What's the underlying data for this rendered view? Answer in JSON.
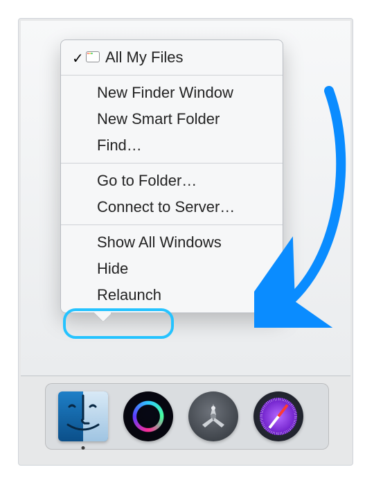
{
  "menu": {
    "items": [
      {
        "label": "All My Files",
        "checked": true,
        "hasWindowIcon": true
      },
      {
        "label": "New Finder Window"
      },
      {
        "label": "New Smart Folder"
      },
      {
        "label": "Find…"
      },
      {
        "label": "Go to Folder…"
      },
      {
        "label": "Connect to Server…"
      },
      {
        "label": "Show All Windows"
      },
      {
        "label": "Hide"
      },
      {
        "label": "Relaunch"
      }
    ]
  },
  "dock": {
    "items": [
      {
        "name": "finder-icon",
        "running": true
      },
      {
        "name": "siri-icon"
      },
      {
        "name": "launchpad-icon"
      },
      {
        "name": "safari-icon"
      }
    ]
  },
  "colors": {
    "highlight": "#25c3ff",
    "arrow": "#0a8cff"
  }
}
